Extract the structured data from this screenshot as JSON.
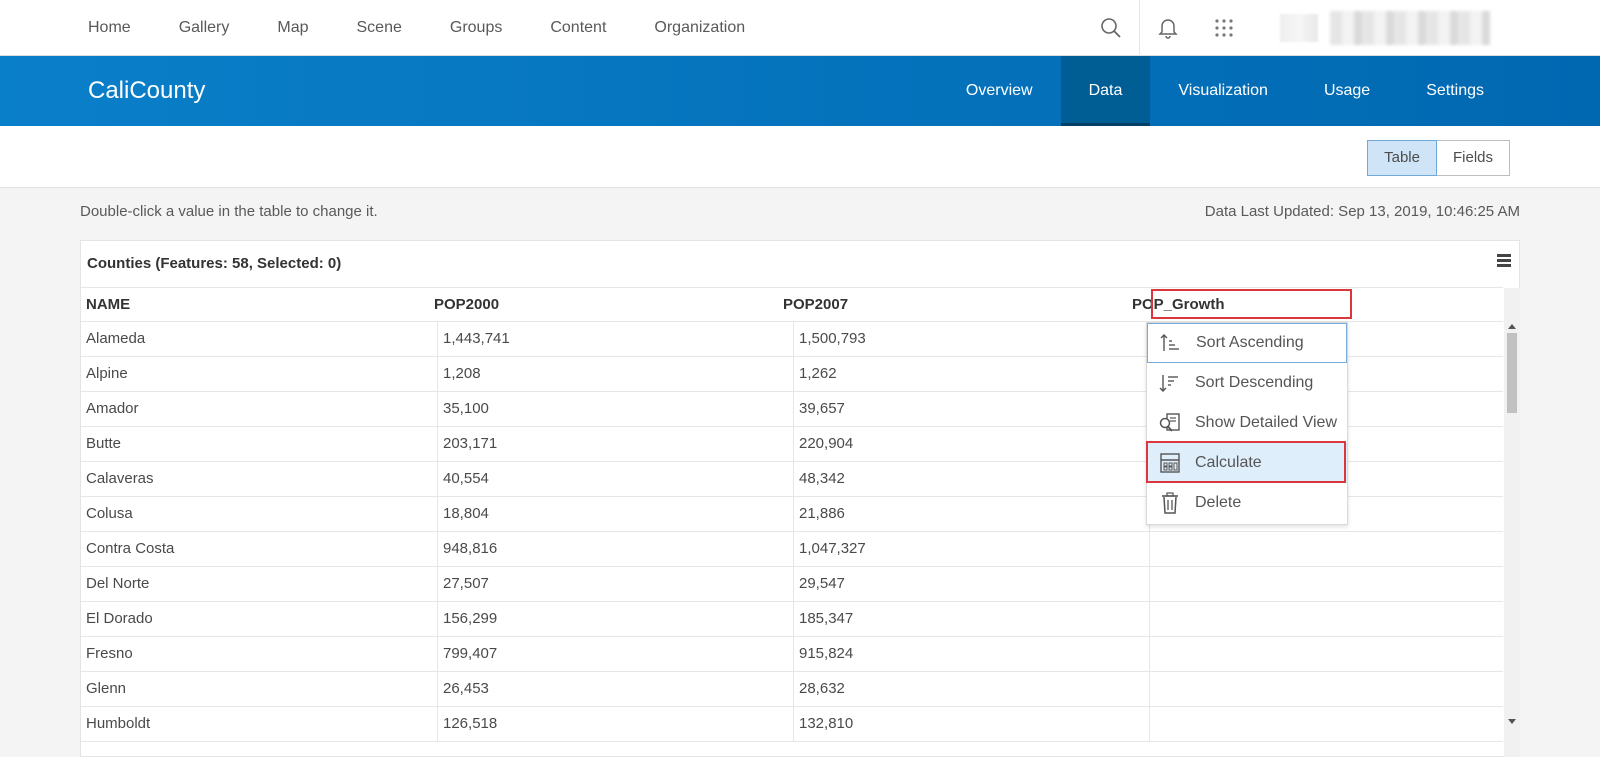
{
  "topnav": {
    "links": [
      "Home",
      "Gallery",
      "Map",
      "Scene",
      "Groups",
      "Content",
      "Organization"
    ]
  },
  "header": {
    "title": "CaliCounty",
    "tabs": [
      "Overview",
      "Data",
      "Visualization",
      "Usage",
      "Settings"
    ],
    "active_tab": "Data"
  },
  "view_toggle": {
    "table": "Table",
    "fields": "Fields"
  },
  "hint": "Double-click a value in the table to change it.",
  "updated": "Data Last Updated: Sep 13, 2019, 10:46:25 AM",
  "table": {
    "title": "Counties (Features: 58, Selected: 0)",
    "columns": [
      "NAME",
      "POP2000",
      "POP2007",
      "POP_Growth"
    ],
    "rows": [
      [
        "Alameda",
        "1,443,741",
        "1,500,793",
        ""
      ],
      [
        "Alpine",
        "1,208",
        "1,262",
        ""
      ],
      [
        "Amador",
        "35,100",
        "39,657",
        ""
      ],
      [
        "Butte",
        "203,171",
        "220,904",
        ""
      ],
      [
        "Calaveras",
        "40,554",
        "48,342",
        ""
      ],
      [
        "Colusa",
        "18,804",
        "21,886",
        ""
      ],
      [
        "Contra Costa",
        "948,816",
        "1,047,327",
        ""
      ],
      [
        "Del Norte",
        "27,507",
        "29,547",
        ""
      ],
      [
        "El Dorado",
        "156,299",
        "185,347",
        ""
      ],
      [
        "Fresno",
        "799,407",
        "915,824",
        ""
      ],
      [
        "Glenn",
        "26,453",
        "28,632",
        ""
      ],
      [
        "Humboldt",
        "126,518",
        "132,810",
        ""
      ]
    ]
  },
  "column_menu": {
    "items": [
      {
        "label": "Sort Ascending",
        "icon": "sort-ascending-icon"
      },
      {
        "label": "Sort Descending",
        "icon": "sort-descending-icon"
      },
      {
        "label": "Show Detailed View",
        "icon": "detailed-view-icon"
      },
      {
        "label": "Calculate",
        "icon": "calculator-icon"
      },
      {
        "label": "Delete",
        "icon": "trash-icon"
      }
    ]
  },
  "colors": {
    "header_blue": "#0068b1",
    "active_tab": "#005e95",
    "highlight_red": "#d9363e",
    "toggle_selected": "#cfe5f7"
  }
}
